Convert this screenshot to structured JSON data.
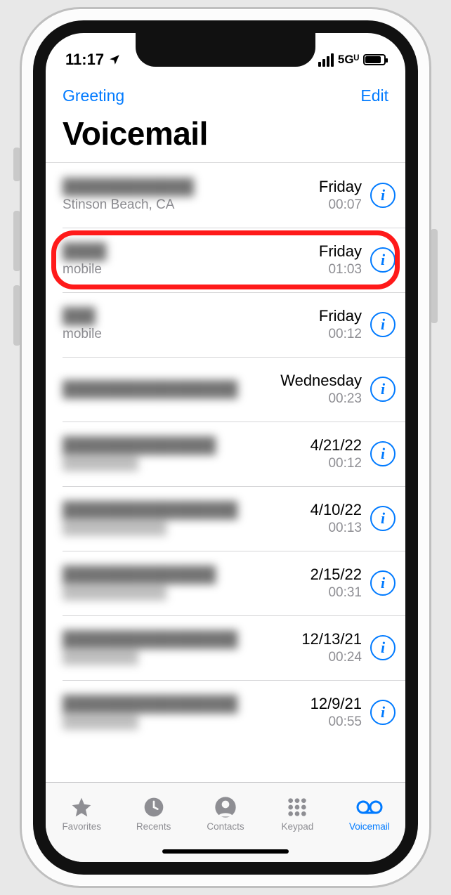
{
  "status": {
    "time": "11:17",
    "network": "5Gᵁ"
  },
  "nav": {
    "left": "Greeting",
    "right": "Edit",
    "title": "Voicemail"
  },
  "voicemails": [
    {
      "name": "████████████",
      "sub": "Stinson Beach, CA",
      "date": "Friday",
      "duration": "00:07",
      "blur_name": true,
      "highlight": false
    },
    {
      "name": "████",
      "sub": "mobile",
      "date": "Friday",
      "duration": "01:03",
      "blur_name": true,
      "highlight": true
    },
    {
      "name": "███",
      "sub": "mobile",
      "date": "Friday",
      "duration": "00:12",
      "blur_name": true,
      "highlight": false
    },
    {
      "name": "████████████████",
      "sub": "",
      "date": "Wednesday",
      "duration": "00:23",
      "blur_name": true,
      "highlight": false
    },
    {
      "name": "██████████████",
      "sub": "████████",
      "date": "4/21/22",
      "duration": "00:12",
      "blur_name": true,
      "blur_sub": true,
      "highlight": false
    },
    {
      "name": "████████████████",
      "sub": "███████████",
      "date": "4/10/22",
      "duration": "00:13",
      "blur_name": true,
      "blur_sub": true,
      "highlight": false
    },
    {
      "name": "██████████████",
      "sub": "███████████",
      "date": "2/15/22",
      "duration": "00:31",
      "blur_name": true,
      "blur_sub": true,
      "highlight": false
    },
    {
      "name": "████████████████",
      "sub": "████████",
      "date": "12/13/21",
      "duration": "00:24",
      "blur_name": true,
      "blur_sub": true,
      "highlight": false
    },
    {
      "name": "████████████████",
      "sub": "████████",
      "date": "12/9/21",
      "duration": "00:55",
      "blur_name": true,
      "blur_sub": true,
      "highlight": false
    }
  ],
  "tabs": {
    "favorites": "Favorites",
    "recents": "Recents",
    "contacts": "Contacts",
    "keypad": "Keypad",
    "voicemail": "Voicemail"
  }
}
